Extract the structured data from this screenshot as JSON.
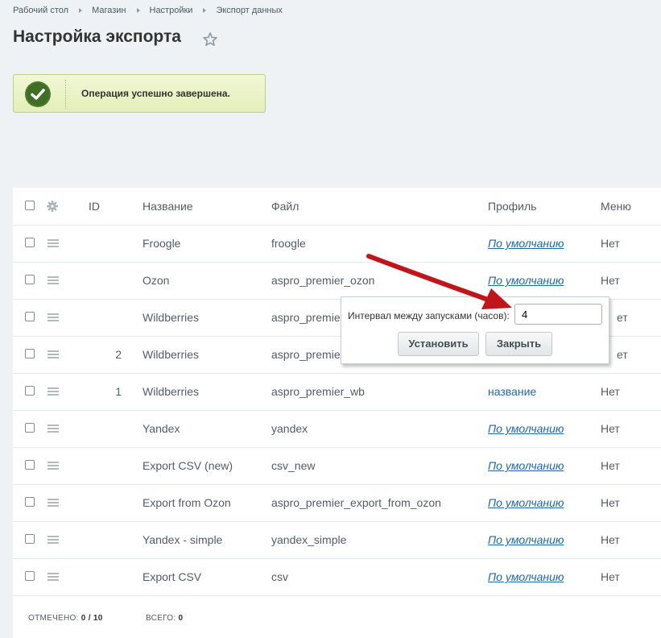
{
  "breadcrumb": [
    "Рабочий стол",
    "Магазин",
    "Настройки",
    "Экспорт данных"
  ],
  "page_title": "Настройка экспорта",
  "alert": {
    "message": "Операция успешно завершена."
  },
  "table": {
    "headers": {
      "id": "ID",
      "name": "Название",
      "file": "Файл",
      "profile": "Профиль",
      "menu": "Меню"
    },
    "rows": [
      {
        "id": "",
        "name": "Froogle",
        "file": "froogle",
        "profile": "По умолчанию",
        "menu": "Нет"
      },
      {
        "id": "",
        "name": "Ozon",
        "file": "aspro_premier_ozon",
        "profile": "По умолчанию",
        "menu": "Нет"
      },
      {
        "id": "",
        "name": "Wildberries",
        "file": "aspro_premie",
        "profile": "",
        "menu": "ет"
      },
      {
        "id": "2",
        "name": "Wildberries",
        "file": "aspro_premie",
        "profile": "",
        "menu": "ет"
      },
      {
        "id": "1",
        "name": "Wildberries",
        "file": "aspro_premier_wb",
        "profile": "название",
        "menu": "Нет"
      },
      {
        "id": "",
        "name": "Yandex",
        "file": "yandex",
        "profile": "По умолчанию",
        "menu": "Нет"
      },
      {
        "id": "",
        "name": "Export CSV (new)",
        "file": "csv_new",
        "profile": "По умолчанию",
        "menu": "Нет"
      },
      {
        "id": "",
        "name": "Export from Ozon",
        "file": "aspro_premier_export_from_ozon",
        "profile": "По умолчанию",
        "menu": "Нет"
      },
      {
        "id": "",
        "name": "Yandex - simple",
        "file": "yandex_simple",
        "profile": "По умолчанию",
        "menu": "Нет"
      },
      {
        "id": "",
        "name": "Export CSV",
        "file": "csv",
        "profile": "По умолчанию",
        "menu": "Нет"
      }
    ]
  },
  "footer": {
    "checked_label": "ОТМЕЧЕНО:",
    "checked_value": "0 / 10",
    "total_label": "ВСЕГО:",
    "total_value": "0"
  },
  "popup": {
    "label": "Интервал между запусками (часов):",
    "value": "4",
    "set_button": "Установить",
    "close_button": "Закрыть"
  },
  "colors": {
    "accent_link": "#2067b0",
    "success": "#4b7a2e",
    "arrow": "#c0161a"
  }
}
